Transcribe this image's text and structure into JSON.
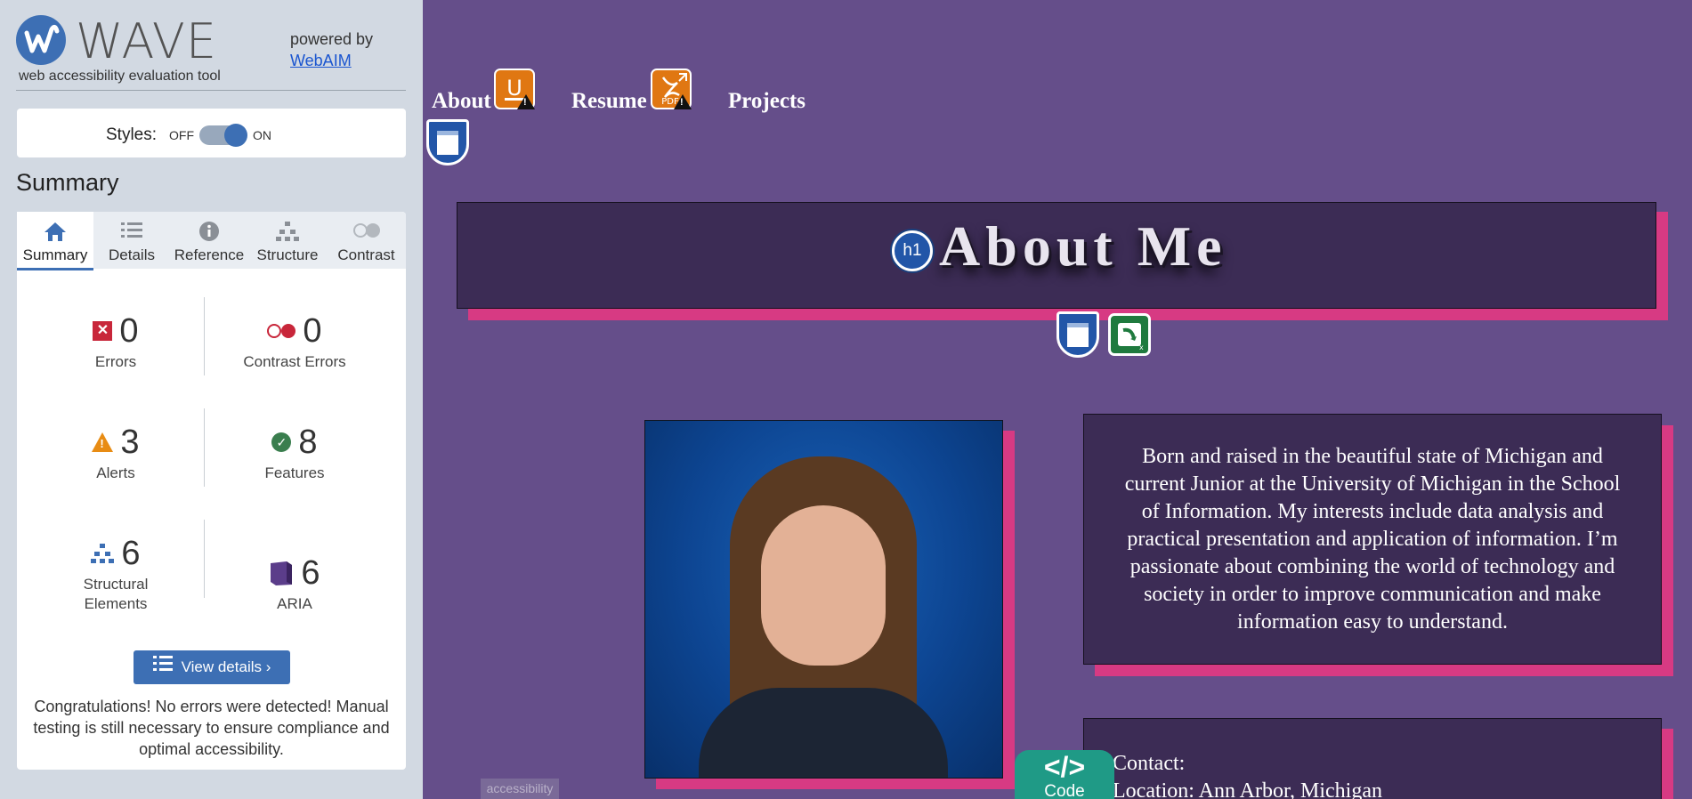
{
  "wave": {
    "title": "WAVE",
    "tagline": "web accessibility evaluation tool",
    "powered_by": "powered by",
    "webaim_link": "WebAIM",
    "styles_label": "Styles:",
    "toggle_off": "OFF",
    "toggle_on": "ON",
    "toggle_state": "on",
    "summary_heading": "Summary",
    "tabs": [
      {
        "label": "Summary",
        "icon": "home-icon",
        "active": true
      },
      {
        "label": "Details",
        "icon": "list-icon",
        "active": false
      },
      {
        "label": "Reference",
        "icon": "info-icon",
        "active": false
      },
      {
        "label": "Structure",
        "icon": "hierarchy-icon",
        "active": false
      },
      {
        "label": "Contrast",
        "icon": "contrast-icon",
        "active": false
      }
    ],
    "stats": {
      "errors": {
        "count": "0",
        "label": "Errors"
      },
      "contrast_errors": {
        "count": "0",
        "label": "Contrast Errors"
      },
      "alerts": {
        "count": "3",
        "label": "Alerts"
      },
      "features": {
        "count": "8",
        "label": "Features"
      },
      "structural": {
        "count": "6",
        "label": "Structural Elements"
      },
      "aria": {
        "count": "6",
        "label": "ARIA"
      }
    },
    "view_details_button": "View details ›",
    "congrats_message": "Congratulations! No errors were detected! Manual testing is still necessary to ensure compliance and optimal accessibility.",
    "colors": {
      "accent": "#3d6fb4",
      "error": "#c8263a",
      "alert": "#e88c14",
      "feature": "#3a7e4e",
      "aria": "#5b3d8a"
    }
  },
  "page": {
    "nav": [
      {
        "label": "About"
      },
      {
        "label": "Resume"
      },
      {
        "label": "Projects"
      }
    ],
    "heading": "About Me",
    "h1_badge": "h1",
    "bio": "Born and raised in the beautiful state of Michigan and current Junior at the University of Michigan in the School of Information. My interests include data analysis and practical presentation and application of information. I’m passionate about combining the world of technology and society in order to improve communication and make information easy to understand.",
    "contact_heading": "Contact:",
    "contact_location": "Location: Ann Arbor, Michigan",
    "code_badge_symbol": "</>",
    "code_badge_label": "Code",
    "accessibility_label": "accessibility",
    "colors": {
      "background": "#654e8a",
      "box": "#3c2c55",
      "accent_shadow": "#d73a83"
    }
  }
}
